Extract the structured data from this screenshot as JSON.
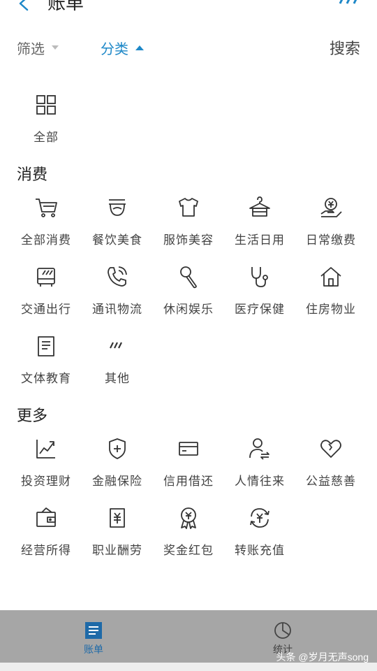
{
  "header": {
    "title": "账单"
  },
  "filter": {
    "screen_label": "筛选",
    "category_label": "分类",
    "search_label": "搜索"
  },
  "all": {
    "label": "全部",
    "icon": "grid-icon"
  },
  "consume": {
    "title": "消费",
    "items": [
      {
        "label": "全部消费",
        "icon": "cart-icon"
      },
      {
        "label": "餐饮美食",
        "icon": "bowl-icon"
      },
      {
        "label": "服饰美容",
        "icon": "shirt-icon"
      },
      {
        "label": "生活日用",
        "icon": "hanger-icon"
      },
      {
        "label": "日常缴费",
        "icon": "bill-hand-icon"
      },
      {
        "label": "交通出行",
        "icon": "bus-icon"
      },
      {
        "label": "通讯物流",
        "icon": "phone-icon"
      },
      {
        "label": "休闲娱乐",
        "icon": "microphone-icon"
      },
      {
        "label": "医疗保健",
        "icon": "stethoscope-icon"
      },
      {
        "label": "住房物业",
        "icon": "house-icon"
      },
      {
        "label": "文体教育",
        "icon": "book-icon"
      },
      {
        "label": "其他",
        "icon": "slashes-icon"
      }
    ]
  },
  "more": {
    "title": "更多",
    "items": [
      {
        "label": "投资理财",
        "icon": "chart-up-icon"
      },
      {
        "label": "金融保险",
        "icon": "shield-plus-icon"
      },
      {
        "label": "信用借还",
        "icon": "card-icon"
      },
      {
        "label": "人情往来",
        "icon": "person-exchange-icon"
      },
      {
        "label": "公益慈善",
        "icon": "heart-icon"
      },
      {
        "label": "经营所得",
        "icon": "wallet-icon"
      },
      {
        "label": "职业酬劳",
        "icon": "yuan-doc-icon"
      },
      {
        "label": "奖金红包",
        "icon": "medal-icon"
      },
      {
        "label": "转账充值",
        "icon": "yuan-cycle-icon"
      }
    ]
  },
  "tabs": {
    "bill": "账单",
    "stats": "统计"
  },
  "watermark": "头条 @岁月无声song",
  "colors": {
    "accent": "#1e88c8",
    "tabbar": "#a6a6a6"
  }
}
